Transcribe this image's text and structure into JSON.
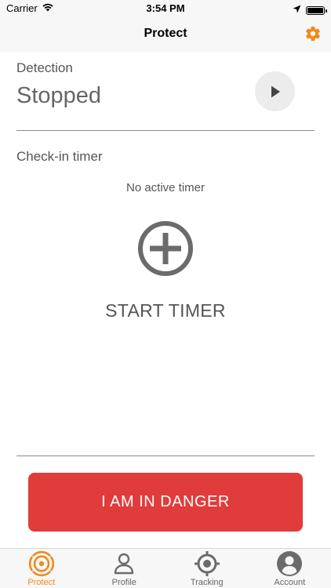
{
  "status_bar": {
    "carrier": "Carrier",
    "time": "3:54 PM"
  },
  "nav": {
    "title": "Protect",
    "settings_icon": "gear-icon"
  },
  "detection": {
    "label": "Detection",
    "status": "Stopped",
    "play_icon": "play-icon"
  },
  "checkin": {
    "label": "Check-in timer",
    "empty_text": "No active timer",
    "start_label": "START TIMER",
    "add_icon": "plus-circle-icon"
  },
  "danger": {
    "label": "I AM IN DANGER"
  },
  "tabs": [
    {
      "label": "Protect",
      "icon": "protect-radar-icon",
      "active": true
    },
    {
      "label": "Profile",
      "icon": "person-icon",
      "active": false
    },
    {
      "label": "Tracking",
      "icon": "crosshair-icon",
      "active": false
    },
    {
      "label": "Account",
      "icon": "account-circle-icon",
      "active": false
    }
  ],
  "colors": {
    "accent": "#f08a1c",
    "danger": "#e13c3c",
    "icon_gray": "#6b6b6b"
  }
}
